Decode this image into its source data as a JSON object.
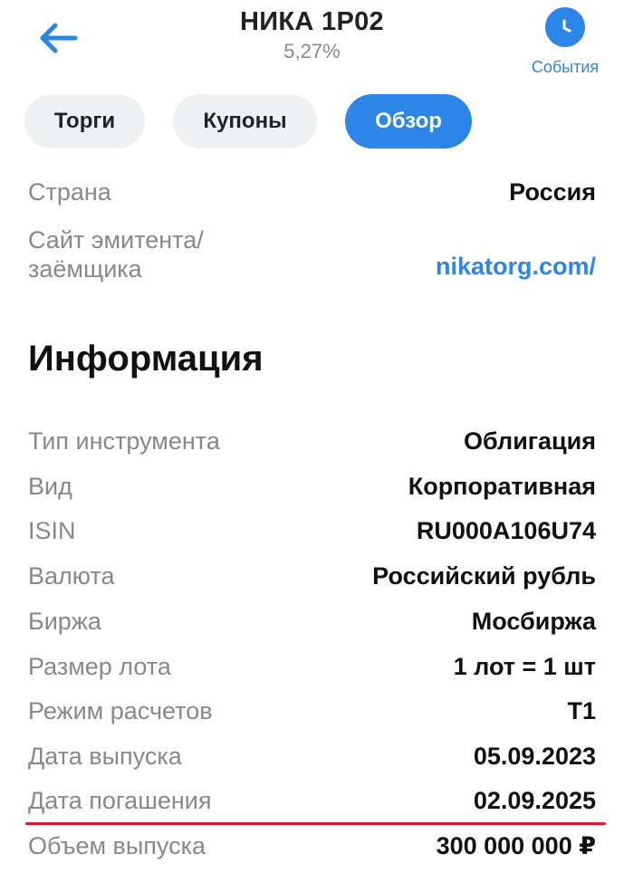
{
  "header": {
    "title": "НИКА 1P02",
    "subtitle": "5,27%",
    "events_label": "События"
  },
  "tabs": [
    {
      "label": "Торги",
      "active": false
    },
    {
      "label": "Купоны",
      "active": false
    },
    {
      "label": "Обзор",
      "active": true
    }
  ],
  "issuer": {
    "country_label": "Страна",
    "country_value": "Россия",
    "site_label_line1": "Сайт эмитента/",
    "site_label_line2": "заёмщика",
    "site_value": "nikatorg.com/"
  },
  "info": {
    "title": "Информация",
    "rows": [
      {
        "label": "Тип инструмента",
        "value": "Облигация"
      },
      {
        "label": "Вид",
        "value": "Корпоративная"
      },
      {
        "label": "ISIN",
        "value": "RU000A106U74"
      },
      {
        "label": "Валюта",
        "value": "Российский рубль"
      },
      {
        "label": "Биржа",
        "value": "Мосбиржа"
      },
      {
        "label": "Размер лота",
        "value": "1 лот = 1 шт"
      },
      {
        "label": "Режим расчетов",
        "value": "T1"
      },
      {
        "label": "Дата выпуска",
        "value": "05.09.2023"
      },
      {
        "label": "Дата погашения",
        "value": "02.09.2025"
      },
      {
        "label": "Объем выпуска",
        "value": "300 000 000 ₽"
      }
    ]
  },
  "icons": {
    "back": "arrow-left-icon",
    "events": "clock-icon"
  },
  "colors": {
    "accent": "#2b86e8",
    "highlight_line": "#e0162b",
    "muted_text": "#888888"
  }
}
